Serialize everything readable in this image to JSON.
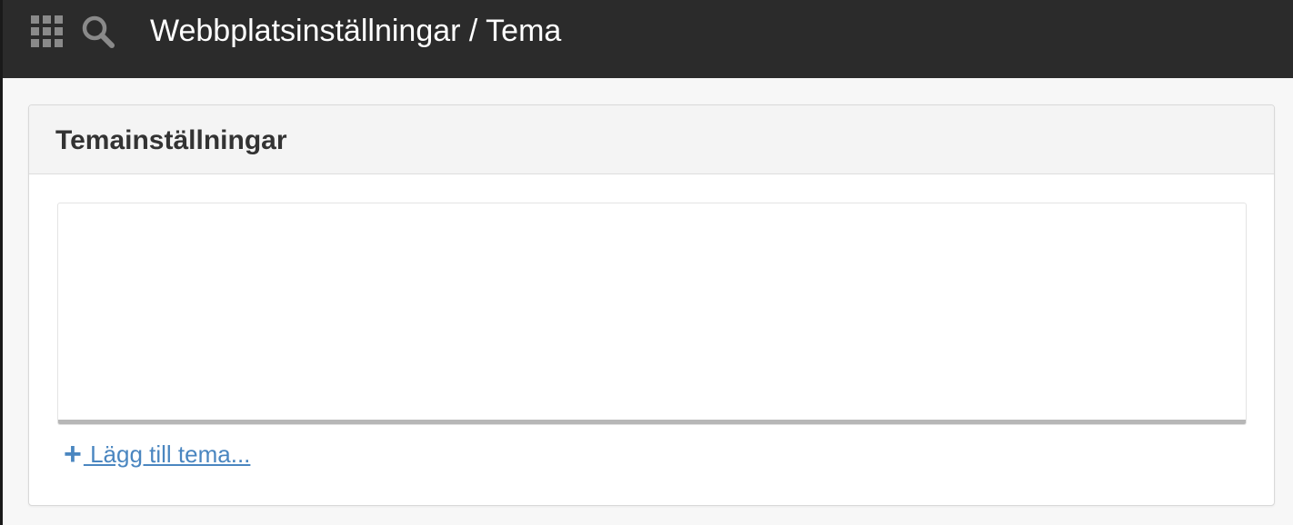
{
  "header": {
    "apps_icon": "waffle-grid-icon",
    "search_icon": "search-icon",
    "title": "Webbplatsinställningar / Tema"
  },
  "panel": {
    "heading": "Temainställningar",
    "add_link": {
      "icon": "plus-icon",
      "label": " Lägg till tema..."
    }
  },
  "colors": {
    "topbar": "#2b2b2b",
    "link": "#4a86c0",
    "heading_text": "#333333",
    "panel_header_bg": "#f4f4f4"
  }
}
